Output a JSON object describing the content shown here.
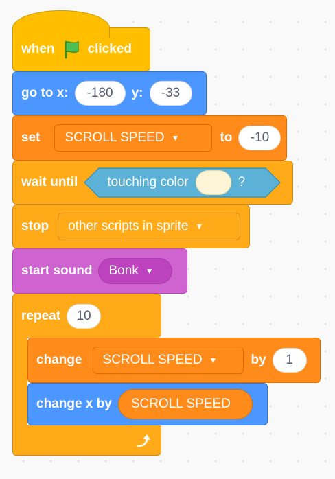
{
  "script": {
    "when_flag": {
      "when": "when",
      "clicked": "clicked",
      "icon": "green-flag-icon"
    },
    "goto": {
      "label": "go to x:",
      "x": "-180",
      "y_label": "y:",
      "y": "-33"
    },
    "set_var": {
      "label": "set",
      "variable": "SCROLL SPEED",
      "to": "to",
      "value": "-10"
    },
    "wait_until": {
      "label": "wait until",
      "condition": "touching color",
      "color": "#fdf5d5",
      "q": "?"
    },
    "stop": {
      "label": "stop",
      "option": "other scripts in sprite"
    },
    "start_sound": {
      "label": "start sound",
      "sound": "Bonk"
    },
    "repeat": {
      "label": "repeat",
      "times": "10",
      "icon": "repeat-arrow-icon"
    },
    "change_var": {
      "label": "change",
      "variable": "SCROLL SPEED",
      "by": "by",
      "value": "1"
    },
    "change_x": {
      "label": "change x by",
      "reporter": "SCROLL SPEED"
    }
  },
  "colors": {
    "events": "#ffbf00",
    "motion": "#4c97ff",
    "variables": "#ff8c1a",
    "control": "#ffab19",
    "sound": "#cf63cf",
    "sensing": "#5cb1d6"
  }
}
